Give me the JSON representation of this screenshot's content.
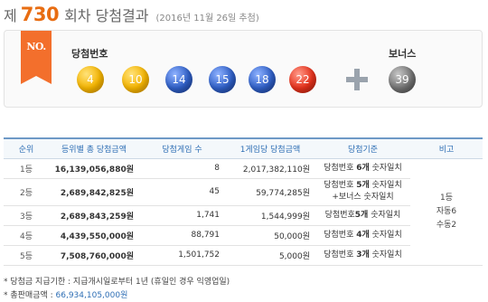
{
  "title": {
    "prefix": "제",
    "round": "730",
    "suffix": "회차 당첨결과",
    "date": "(2016년 11월 26일 추첨)"
  },
  "badge": "NO.",
  "labels": {
    "winning": "당첨번호",
    "bonus": "보너스"
  },
  "winning_numbers": [
    {
      "value": "4",
      "color": "#f4b400"
    },
    {
      "value": "10",
      "color": "#f4b400"
    },
    {
      "value": "14",
      "color": "#2f5fc6"
    },
    {
      "value": "15",
      "color": "#2f5fc6"
    },
    {
      "value": "18",
      "color": "#2f5fc6"
    },
    {
      "value": "22",
      "color": "#e5321c"
    }
  ],
  "bonus_number": {
    "value": "39",
    "color": "#737373"
  },
  "table": {
    "headers": [
      "순위",
      "등위별 총 당첨금액",
      "당첨게임 수",
      "1게임당 당첨금액",
      "당첨기준",
      "비고"
    ],
    "rows": [
      {
        "rank": "1등",
        "total": "16,139,056,880원",
        "games": "8",
        "per": "2,017,382,110원",
        "crit_pre": "당첨번호 ",
        "crit_bold": "6개",
        "crit_post": " 숫자일치",
        "crit2": ""
      },
      {
        "rank": "2등",
        "total": "2,689,842,825원",
        "games": "45",
        "per": "59,774,285원",
        "crit_pre": "당첨번호 ",
        "crit_bold": "5개",
        "crit_post": " 숫자일치",
        "crit2": "+보너스 숫자일치"
      },
      {
        "rank": "3등",
        "total": "2,689,843,259원",
        "games": "1,741",
        "per": "1,544,999원",
        "crit_pre": "당첨번호",
        "crit_bold": "5개",
        "crit_post": " 숫자일치",
        "crit2": ""
      },
      {
        "rank": "4등",
        "total": "4,439,550,000원",
        "games": "88,791",
        "per": "50,000원",
        "crit_pre": "당첨번호 ",
        "crit_bold": "4개",
        "crit_post": " 숫자일치",
        "crit2": ""
      },
      {
        "rank": "5등",
        "total": "7,508,760,000원",
        "games": "1,501,752",
        "per": "5,000원",
        "crit_pre": "당첨번호 ",
        "crit_bold": "3개",
        "crit_post": " 숫자일치",
        "crit2": ""
      }
    ],
    "note": [
      "1등",
      "자동6",
      "수동2"
    ]
  },
  "footer": {
    "line1": "* 당첨금 지급기한 : 지급개시일로부터 1년 (휴일인 경우 익영업일)",
    "line2_label": "* 총판매금액 : ",
    "line2_value": "66,934,105,000원"
  }
}
